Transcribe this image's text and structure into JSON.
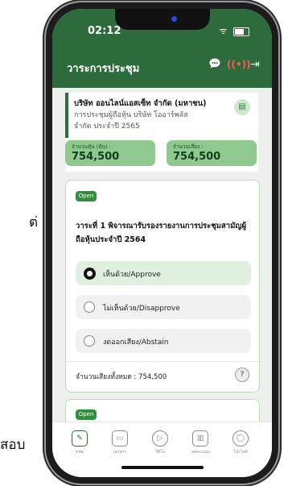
{
  "side_texts": {
    "left_upper": "ต่",
    "left_lower": "สอบ"
  },
  "status_bar": {
    "time": "02:12",
    "signal": "ᯤ"
  },
  "app_bar": {
    "title": "วาระการประชุม",
    "chat_icon": "chat-bubble-icon",
    "live_icon": "broadcast-icon",
    "live_symbol": "((•))",
    "exit_icon": "logout-icon",
    "exit_symbol": "⇥"
  },
  "company": {
    "name": "บริษัท ออนไลน์แอสเซ็ท จำกัด (มหาชน)",
    "description": "การประชุมผู้ถือหุ้น บริษัท โออาร์พลัส จำกัด ประจำปี 2565",
    "doc_icon": "document-icon",
    "doc_symbol": "▤",
    "shares_label": "จำนวนหุ้น (หุ้น) :",
    "shares_value": "754,500",
    "votes_label": "จำนวนเสียง :",
    "votes_value": "754,500"
  },
  "agenda": {
    "status": "Open",
    "title": "วาระที่ 1 พิจารณารับรองรายงานการประชุมสามัญผู้ถือหุ้นประจำปี 2564",
    "options": [
      {
        "label": "เห็นด้วย/Approve",
        "selected": true
      },
      {
        "label": "ไม่เห็นด้วย/Disapprove",
        "selected": false
      },
      {
        "label": "งดออกเสียง/Abstain",
        "selected": false
      }
    ],
    "total_votes": "จำนวนเสียงทั้งหมด : 754,500",
    "help_symbol": "?"
  },
  "next_agenda": {
    "status": "Open"
  },
  "tabbar": {
    "tabs": [
      {
        "label": "วาระ",
        "icon": "agenda-icon",
        "symbol": "✎",
        "active": true
      },
      {
        "label": "เอกสาร",
        "icon": "folder-icon",
        "symbol": "▭",
        "active": false
      },
      {
        "label": "วิดีโอ",
        "icon": "play-icon",
        "symbol": "▷",
        "active": false
      },
      {
        "label": "ผลคะแนน",
        "icon": "report-icon",
        "symbol": "▥",
        "active": false
      },
      {
        "label": "โปรไฟล์",
        "icon": "profile-icon",
        "symbol": "◯",
        "active": false
      }
    ]
  },
  "colors": {
    "brand": "#2e6b3c",
    "accent": "#8fc98f",
    "open_badge": "#2f8f3a",
    "live": "#ff5a5a"
  }
}
